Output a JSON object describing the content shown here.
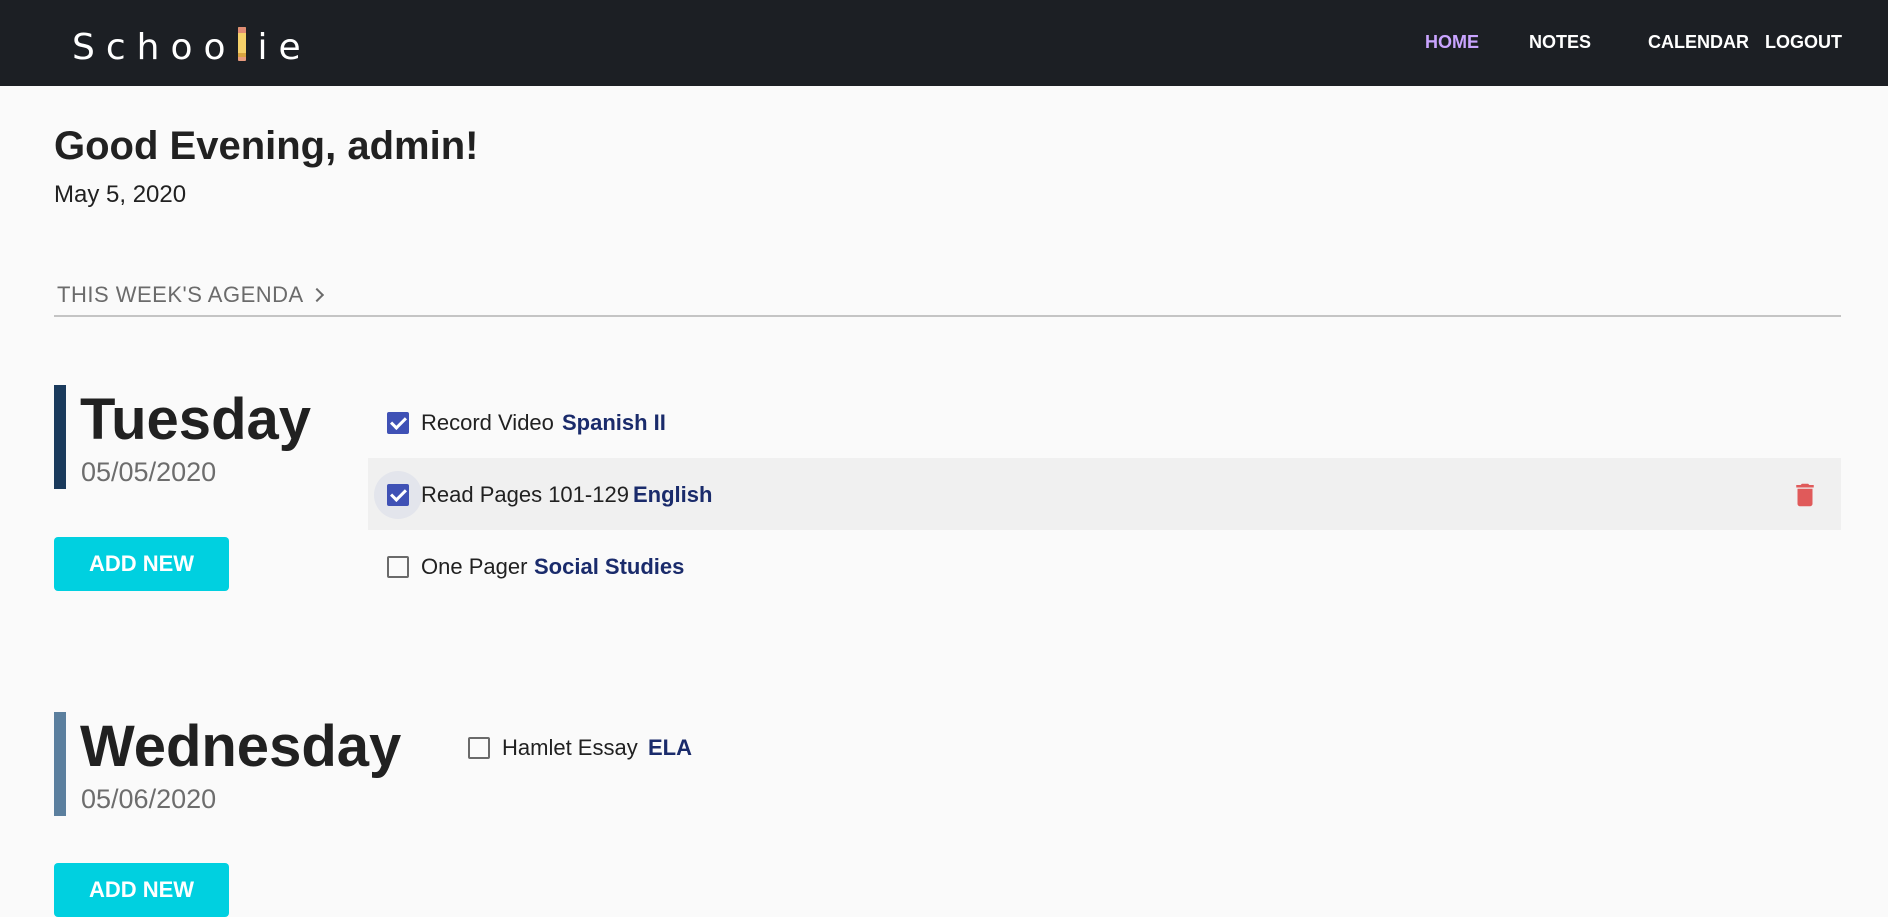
{
  "app": {
    "logo": {
      "before": "Schoo",
      "after": "ie"
    }
  },
  "nav": {
    "items": [
      {
        "label": "HOME",
        "active": true
      },
      {
        "label": "NOTES",
        "active": false
      },
      {
        "label": "CALENDAR",
        "active": false
      },
      {
        "label": "LOGOUT",
        "active": false
      }
    ]
  },
  "greeting": {
    "title": "Good Evening, admin!",
    "date": "May 5, 2020"
  },
  "agenda": {
    "header": "THIS WEEK'S AGENDA"
  },
  "days": [
    {
      "name": "Tuesday",
      "date": "05/05/2020",
      "bar_color": "#1a3a5c",
      "add_label": "ADD NEW",
      "tasks": [
        {
          "title": "Record Video",
          "subject": "Spanish II",
          "checked": true
        },
        {
          "title": "Read Pages 101-129",
          "subject": "English",
          "checked": true,
          "hovered": true,
          "delete_icon": "trash-icon"
        },
        {
          "title": "One Pager",
          "subject": "Social Studies",
          "checked": false
        }
      ]
    },
    {
      "name": "Wednesday",
      "date": "05/06/2020",
      "bar_color": "#5b7f9e",
      "add_label": "ADD NEW",
      "tasks": [
        {
          "title": "Hamlet Essay",
          "subject": "ELA",
          "checked": false
        }
      ]
    }
  ],
  "colors": {
    "topbar": "#1c1f24",
    "nav_active": "#c9a4ff",
    "accent_button": "#00d0e0",
    "checkbox_checked": "#3f51b5",
    "subject_text": "#1a2b6b",
    "delete": "#e05a5a"
  }
}
